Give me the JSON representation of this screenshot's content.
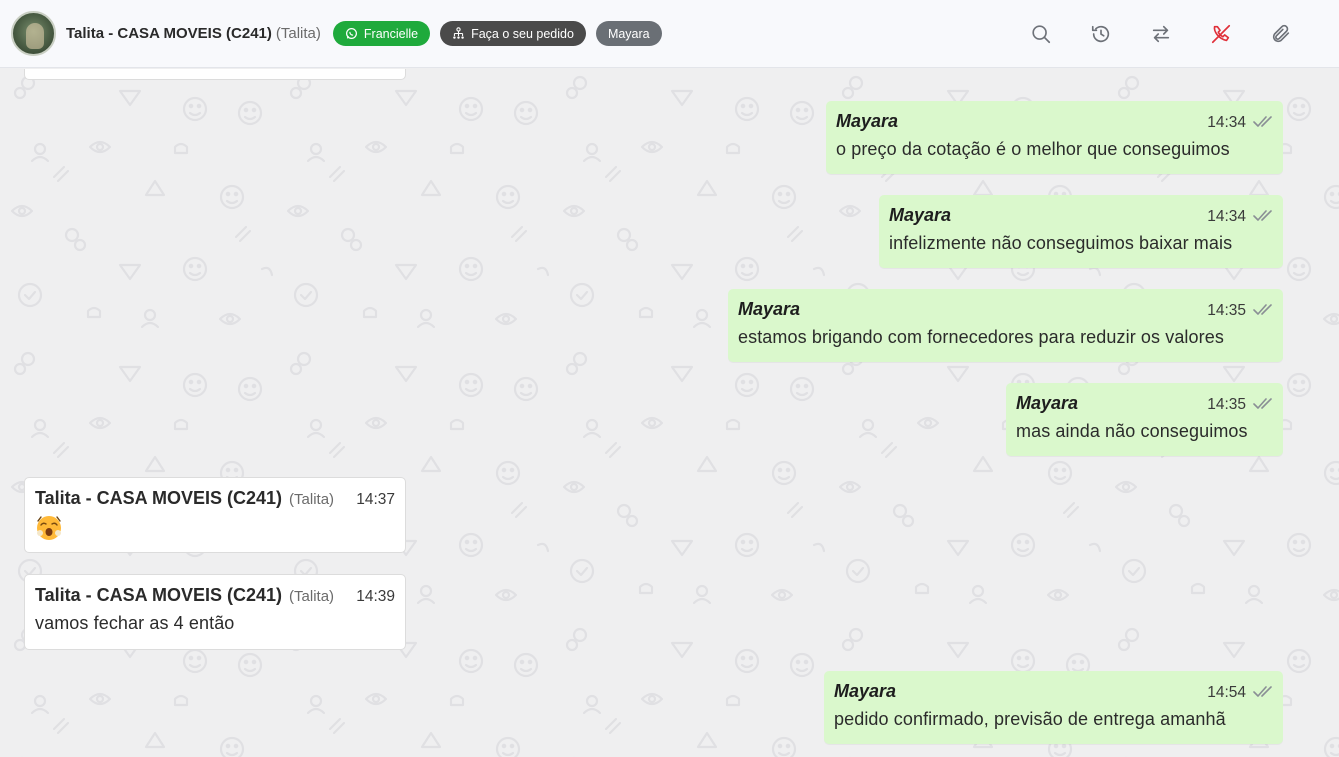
{
  "header": {
    "contact_name": "Talita - CASA MOVEIS (C241)",
    "contact_sub": "(Talita)",
    "chips": [
      {
        "label": "Francielle",
        "icon": "whatsapp-icon",
        "color": "#1faa3c"
      },
      {
        "label": "Faça o seu pedido",
        "icon": "flow-icon",
        "color": "#4a4a4a"
      },
      {
        "label": "Mayara",
        "icon": "",
        "color": "#6a6f75"
      }
    ],
    "toolbar": [
      {
        "icon": "search-icon"
      },
      {
        "icon": "history-icon"
      },
      {
        "icon": "transfer-icon"
      },
      {
        "icon": "end-call-icon",
        "color": "#e0303a"
      },
      {
        "icon": "paperclip-icon"
      }
    ]
  },
  "messages": [
    {
      "direction": "out",
      "sender": "Mayara",
      "time": "14:34",
      "text": "o preço da cotação é o melhor que conseguimos"
    },
    {
      "direction": "out",
      "sender": "Mayara",
      "time": "14:34",
      "text": "infelizmente não conseguimos baixar mais"
    },
    {
      "direction": "out",
      "sender": "Mayara",
      "time": "14:35",
      "text": "estamos brigando com fornecedores para reduzir os valores"
    },
    {
      "direction": "out",
      "sender": "Mayara",
      "time": "14:35",
      "text": "mas ainda não conseguimos"
    },
    {
      "direction": "in",
      "sender": "Talita - CASA MOVEIS (C241)",
      "sender_sub": "(Talita)",
      "time": "14:37",
      "emoji": "shocked-face-icon"
    },
    {
      "direction": "in",
      "sender": "Talita - CASA MOVEIS (C241)",
      "sender_sub": "(Talita)",
      "time": "14:39",
      "text": "vamos fechar as 4 então"
    },
    {
      "direction": "out",
      "sender": "Mayara",
      "time": "14:54",
      "text": "pedido confirmado, previsão de entrega amanhã"
    }
  ],
  "colors": {
    "outgoing_bubble": "#daf8cc",
    "incoming_bubble": "#ffffff",
    "chat_background": "#efeff0"
  }
}
